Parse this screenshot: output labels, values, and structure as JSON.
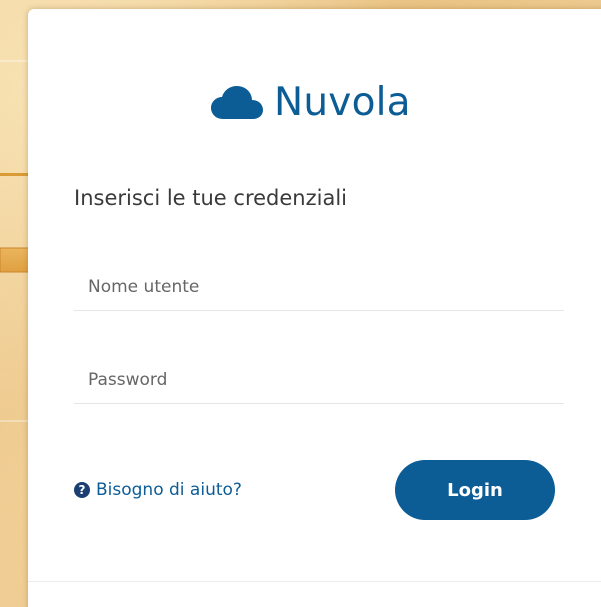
{
  "brand": {
    "name": "Nuvola",
    "icon": "cloud-icon",
    "color": "#0c5d96"
  },
  "form": {
    "heading": "Inserisci le tue credenziali",
    "username_placeholder": "Nome utente",
    "password_placeholder": "Password",
    "help_icon": "question-circle-icon",
    "help_label": "Bisogno di aiuto?",
    "login_label": "Login"
  },
  "background": {
    "arrow_icon": "right-arrow-icon",
    "arrow_color": "#e0a33e"
  }
}
